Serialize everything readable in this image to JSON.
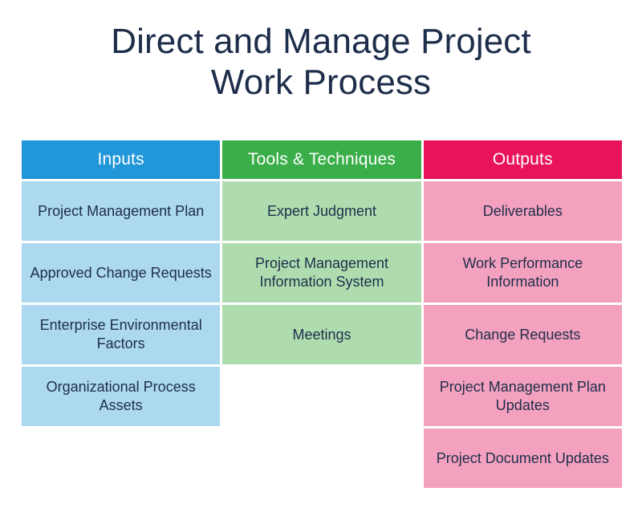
{
  "title": {
    "line1": "Direct and Manage Project",
    "line2": "Work Process"
  },
  "colors": {
    "inputs_header": "#2196D9",
    "tools_header": "#3AAE49",
    "outputs_header": "#E8135B",
    "inputs_cell": "#ACD8F0",
    "tools_cell": "#AEDCAF",
    "outputs_cell": "#F3A1BF",
    "text": "#1E2E4A",
    "header_text": "#FFFFFF",
    "background": "#FFFFFF"
  },
  "table": {
    "row_count": 5,
    "columns": [
      {
        "key": "inputs",
        "header": "Inputs",
        "cells": [
          "Project Management Plan",
          "Approved Change Requests",
          "Enterprise Environmental Factors",
          "Organizational Process Assets",
          ""
        ]
      },
      {
        "key": "tools",
        "header": "Tools & Techniques",
        "cells": [
          "Expert Judgment",
          "Project Management Information System",
          "Meetings",
          "",
          ""
        ]
      },
      {
        "key": "outputs",
        "header": "Outputs",
        "cells": [
          "Deliverables",
          "Work Performance Information",
          "Change Requests",
          "Project Management Plan Updates",
          "Project Document Updates"
        ]
      }
    ]
  }
}
